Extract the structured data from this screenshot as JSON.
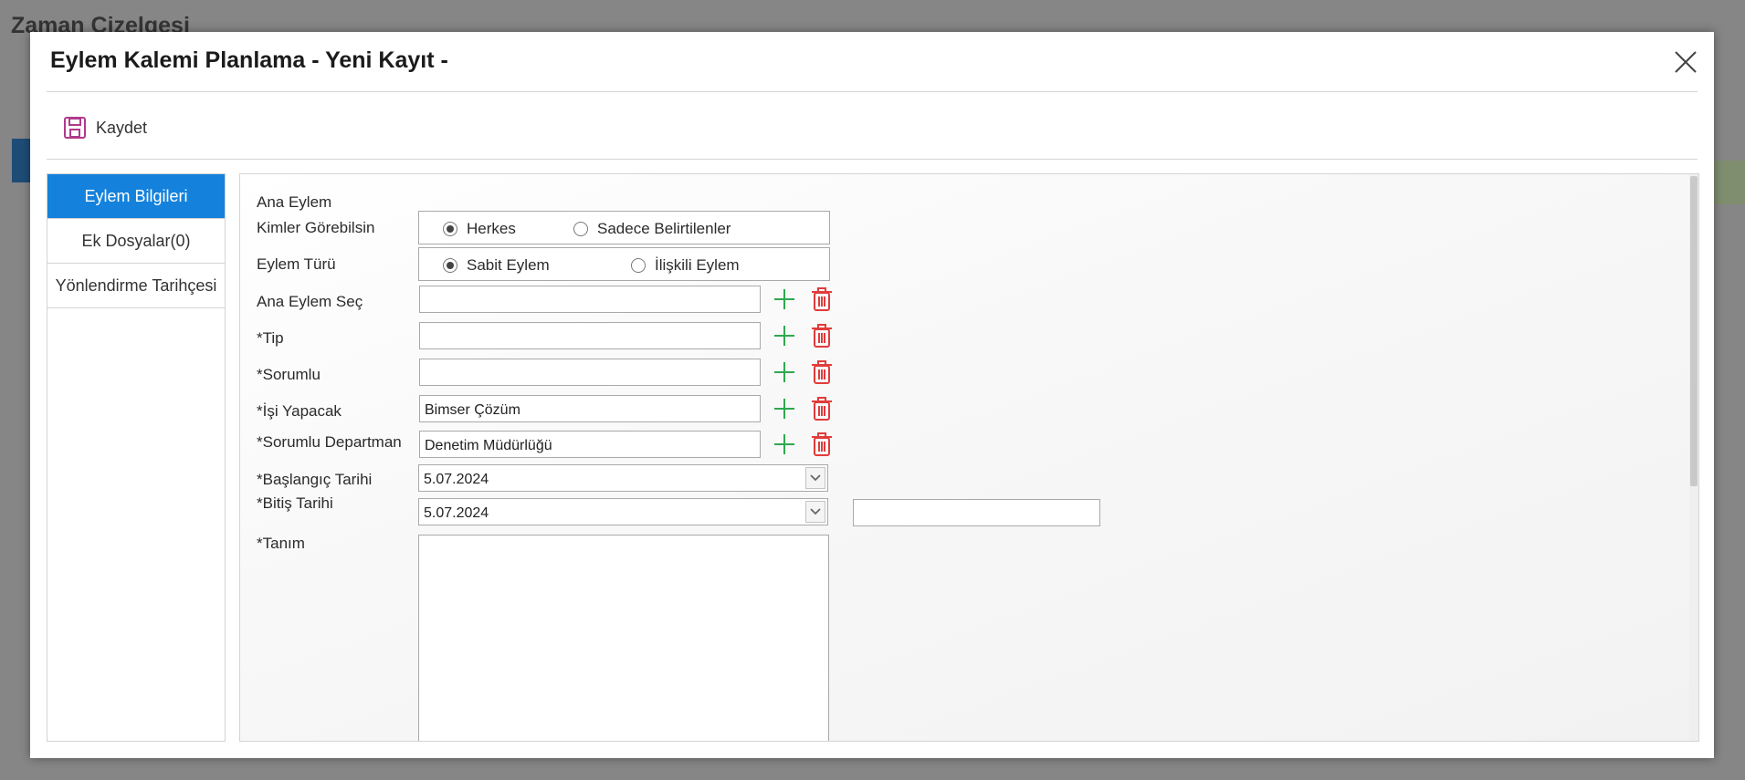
{
  "background": {
    "page_title": "Zaman Çizelgesi"
  },
  "dialog": {
    "title": "Eylem Kalemi Planlama - Yeni Kayıt -",
    "save_label": "Kaydet"
  },
  "tabs": [
    {
      "label": "Eylem Bilgileri",
      "active": true
    },
    {
      "label": "Ek Dosyalar(0)",
      "active": false
    },
    {
      "label": "Yönlendirme Tarihçesi",
      "active": false
    }
  ],
  "form": {
    "ana_eylem": {
      "label": "Ana Eylem"
    },
    "kimler_gorebilsin": {
      "label": "Kimler Görebilsin",
      "options": [
        "Herkes",
        "Sadece Belirtilenler"
      ],
      "selected": "Herkes"
    },
    "eylem_turu": {
      "label": "Eylem Türü",
      "options": [
        "Sabit Eylem",
        "İlişkili Eylem"
      ],
      "selected": "Sabit Eylem"
    },
    "ana_eylem_sec": {
      "label": "Ana Eylem Seç",
      "value": ""
    },
    "tip": {
      "label": "*Tip",
      "value": ""
    },
    "sorumlu": {
      "label": "*Sorumlu",
      "value": ""
    },
    "isi_yapacak": {
      "label": "*İşi Yapacak",
      "value": "Bimser Çözüm"
    },
    "sorumlu_departman": {
      "label": "*Sorumlu Departman",
      "value": "Denetim Müdürlüğü"
    },
    "baslangic_tarihi": {
      "label": "*Başlangıç Tarihi",
      "value": "5.07.2024"
    },
    "bitis_tarihi": {
      "label": "*Bitiş Tarihi",
      "value": "5.07.2024",
      "extra_value": ""
    },
    "tanim": {
      "label": "*Tanım",
      "value": ""
    }
  },
  "colors": {
    "active_tab": "#1482dc",
    "add_icon": "#2fa84f",
    "delete_icon": "#e23b3b",
    "save_icon": "#b03a8c"
  }
}
